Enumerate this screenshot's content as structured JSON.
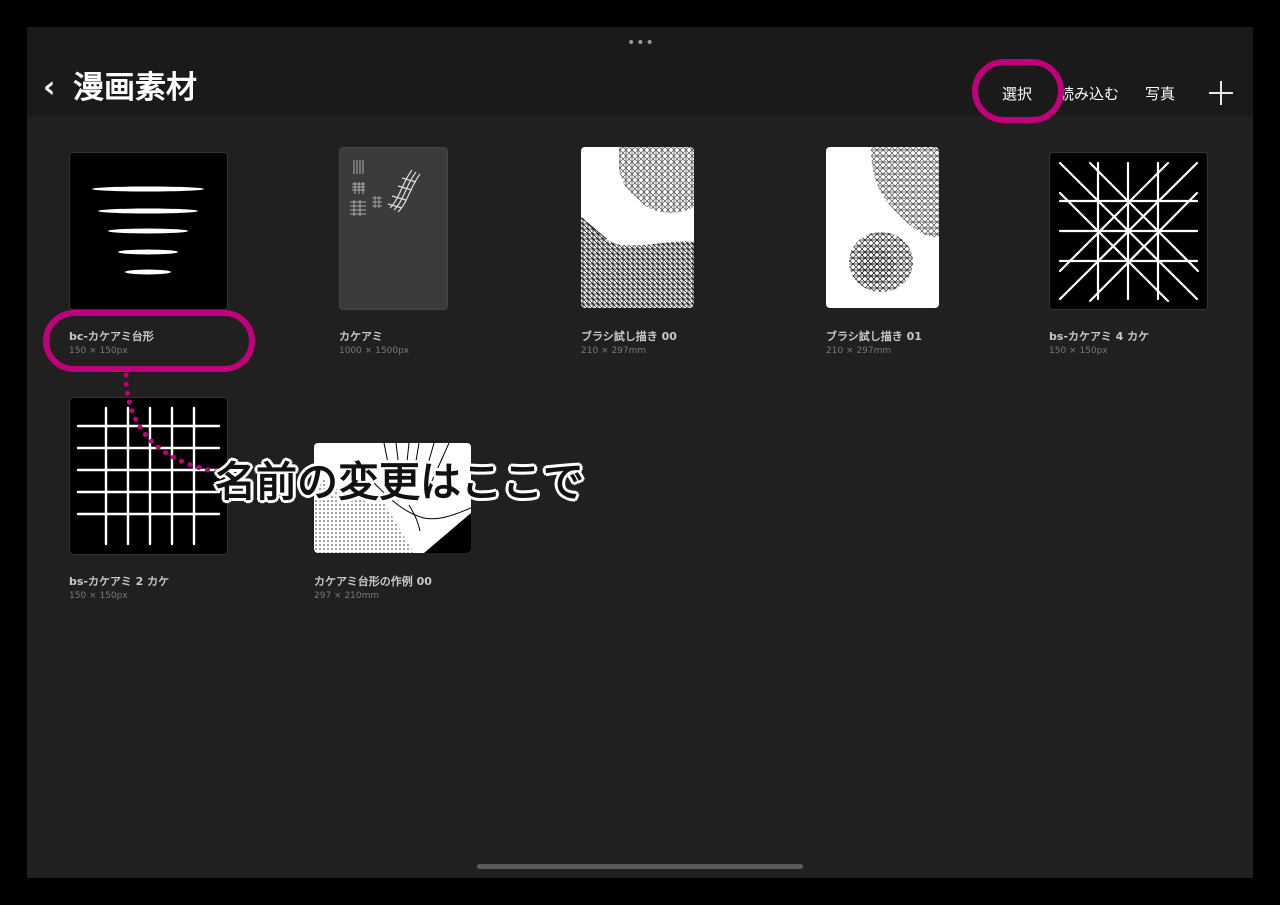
{
  "header": {
    "top_indicator": "•••",
    "back_icon": "chevron-left-icon",
    "title": "漫画素材",
    "select_label": "選択",
    "import_label": "読み込む",
    "photo_label": "写真",
    "add_icon": "plus-icon"
  },
  "gallery": {
    "items": [
      {
        "name": "bc-カケアミ台形",
        "size": "150 × 150px"
      },
      {
        "name": "カケアミ",
        "size": "1000 × 1500px"
      },
      {
        "name": "ブラシ試し描き 00",
        "size": "210 × 297mm"
      },
      {
        "name": "ブラシ試し描き 01",
        "size": "210 × 297mm"
      },
      {
        "name": "bs-カケアミ 4 カケ",
        "size": "150 × 150px"
      },
      {
        "name": "bs-カケアミ 2 カケ",
        "size": "150 × 150px"
      },
      {
        "name": "カケアミ台形の作例 00",
        "size": "297 × 210mm"
      }
    ]
  },
  "annotation": {
    "callout_text": "名前の変更はここで",
    "highlight_color": "#c0007a"
  },
  "colors": {
    "background": "#202020",
    "header": "#1a1a1a",
    "frame": "#000000"
  }
}
